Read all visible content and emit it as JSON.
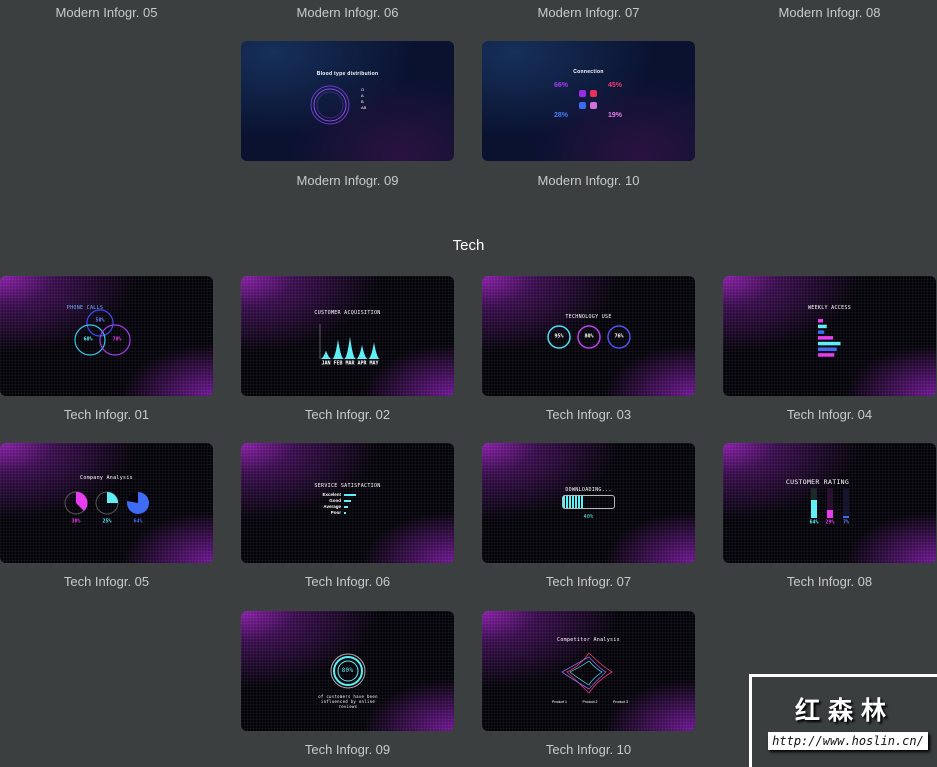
{
  "top_labels": [
    "Modern Infogr. 05",
    "Modern Infogr. 06",
    "Modern Infogr. 07",
    "Modern Infogr. 08"
  ],
  "modern_row": [
    {
      "label": "Modern Infogr. 09",
      "slide_title": "Blood type distribution",
      "legend": [
        "O",
        "A",
        "B",
        "AB"
      ]
    },
    {
      "label": "Modern Infogr. 10",
      "slide_title": "Connection",
      "values": [
        "66%",
        "45%",
        "28%",
        "19%"
      ]
    }
  ],
  "section_title": "Tech",
  "tech": [
    {
      "label": "Tech Infogr. 01",
      "slide_title": "PHONE CALLS",
      "values": [
        "50%",
        "60%",
        "70%"
      ]
    },
    {
      "label": "Tech Infogr. 02",
      "slide_title": "CUSTOMER ACQUISITION",
      "chart_values": [
        30,
        70,
        80,
        50,
        60
      ],
      "months": [
        "JAN",
        "FEB",
        "MAR",
        "APR",
        "MAY"
      ]
    },
    {
      "label": "Tech Infogr. 03",
      "slide_title": "TECHNOLOGY USE",
      "values": [
        "95%",
        "80%",
        "76%"
      ]
    },
    {
      "label": "Tech Infogr. 04",
      "slide_title": "WEEKLY ACCESS",
      "bar_values": [
        20,
        35,
        25,
        60,
        90,
        75,
        65
      ]
    },
    {
      "label": "Tech Infogr. 05",
      "slide_title": "Company Analysis",
      "values": [
        "30%",
        "25%",
        "64%"
      ]
    },
    {
      "label": "Tech Infogr. 06",
      "slide_title": "SERVICE SATISFACTION",
      "rows": [
        "Excelent",
        "Good",
        "Average",
        "Poor"
      ]
    },
    {
      "label": "Tech Infogr. 07",
      "slide_title": "DOWNLOADING...",
      "value": "40%",
      "progress": 0.4
    },
    {
      "label": "Tech Infogr. 08",
      "slide_title": "CUSTOMER RATING",
      "values": [
        "64%",
        "29%",
        "7%"
      ]
    },
    {
      "label": "Tech Infogr. 09",
      "slide_title": "of customers have been influenced by online reviews",
      "value": "80%"
    },
    {
      "label": "Tech Infogr. 10",
      "slide_title": "Competitor Analysis",
      "legend": [
        "Product 1",
        "Product 2",
        "Product 3"
      ]
    }
  ],
  "watermark": {
    "name": "红森林",
    "url": "http://www.hoslin.cn/"
  },
  "colors": {
    "background": "#3b3f3f",
    "cyan": "#5ef0f5",
    "magenta": "#e83cf0",
    "blue": "#3f6cf5"
  }
}
